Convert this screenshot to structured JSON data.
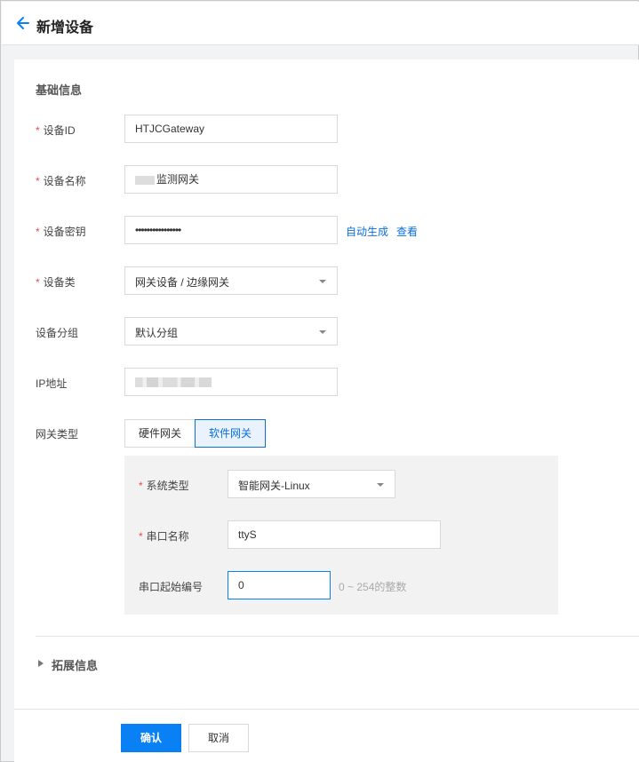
{
  "header": {
    "title": "新增设备"
  },
  "basic": {
    "section_title": "基础信息",
    "required_mark": "*",
    "device_id": {
      "label": "设备ID",
      "value": "HTJCGateway"
    },
    "device_name": {
      "label": "设备名称",
      "value": "监测网关"
    },
    "device_secret": {
      "label": "设备密钥",
      "value": "••••••••••••••••",
      "auto_generate": "自动生成",
      "view": "查看"
    },
    "device_type": {
      "label": "设备类",
      "value": "网关设备 / 边缘网关"
    },
    "device_group": {
      "label": "设备分组",
      "value": "默认分组"
    },
    "ip": {
      "label": "IP地址",
      "value": ""
    },
    "gateway_type": {
      "label": "网关类型",
      "options": [
        "硬件网关",
        "软件网关"
      ],
      "selected": "软件网关"
    }
  },
  "software_gateway": {
    "system_type": {
      "label": "系统类型",
      "value": "智能网关-Linux"
    },
    "serial_name": {
      "label": "串口名称",
      "value": "ttyS"
    },
    "serial_start": {
      "label": "串口起始编号",
      "value": "0",
      "hint": "0 ~ 254的整数"
    }
  },
  "extended": {
    "label": "拓展信息"
  },
  "footer": {
    "confirm": "确认",
    "cancel": "取消"
  },
  "colors": {
    "accent": "#0a80f5",
    "link": "#0a6fd8",
    "required": "#e34d4d"
  }
}
